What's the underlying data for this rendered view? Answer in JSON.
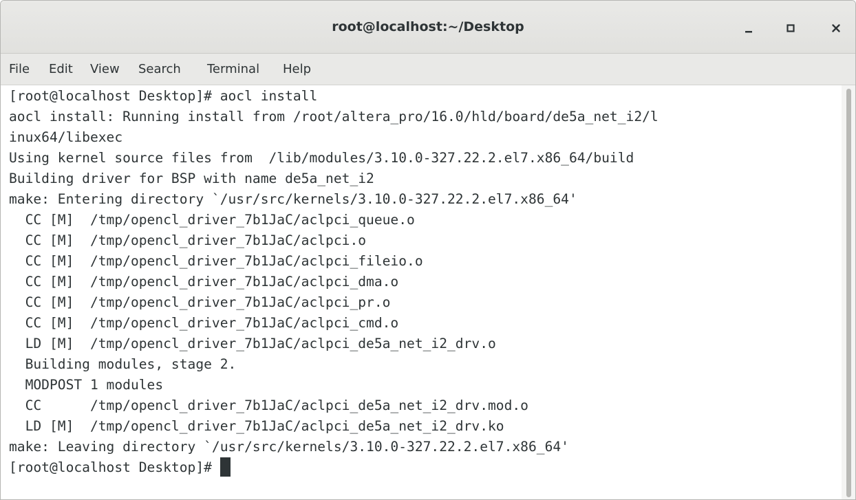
{
  "window": {
    "title": "root@localhost:~/Desktop",
    "controls": {
      "minimize": "minimize-icon",
      "maximize": "maximize-icon",
      "close": "close-icon"
    }
  },
  "menubar": {
    "items": [
      {
        "label": "File"
      },
      {
        "label": "Edit"
      },
      {
        "label": "View"
      },
      {
        "label": "Search"
      },
      {
        "label": "Terminal"
      },
      {
        "label": "Help"
      }
    ]
  },
  "terminal": {
    "lines": [
      "[root@localhost Desktop]# aocl install",
      "aocl install: Running install from /root/altera_pro/16.0/hld/board/de5a_net_i2/l",
      "inux64/libexec",
      "Using kernel source files from  /lib/modules/3.10.0-327.22.2.el7.x86_64/build",
      "Building driver for BSP with name de5a_net_i2",
      "make: Entering directory `/usr/src/kernels/3.10.0-327.22.2.el7.x86_64'",
      "  CC [M]  /tmp/opencl_driver_7b1JaC/aclpci_queue.o",
      "  CC [M]  /tmp/opencl_driver_7b1JaC/aclpci.o",
      "  CC [M]  /tmp/opencl_driver_7b1JaC/aclpci_fileio.o",
      "  CC [M]  /tmp/opencl_driver_7b1JaC/aclpci_dma.o",
      "  CC [M]  /tmp/opencl_driver_7b1JaC/aclpci_pr.o",
      "  CC [M]  /tmp/opencl_driver_7b1JaC/aclpci_cmd.o",
      "  LD [M]  /tmp/opencl_driver_7b1JaC/aclpci_de5a_net_i2_drv.o",
      "  Building modules, stage 2.",
      "  MODPOST 1 modules",
      "  CC      /tmp/opencl_driver_7b1JaC/aclpci_de5a_net_i2_drv.mod.o",
      "  LD [M]  /tmp/opencl_driver_7b1JaC/aclpci_de5a_net_i2_drv.ko",
      "make: Leaving directory `/usr/src/kernels/3.10.0-327.22.2.el7.x86_64'"
    ],
    "prompt": "[root@localhost Desktop]# "
  },
  "colors": {
    "text": "#2e3436",
    "background": "#ffffff",
    "chrome": "#e9e9e7"
  }
}
